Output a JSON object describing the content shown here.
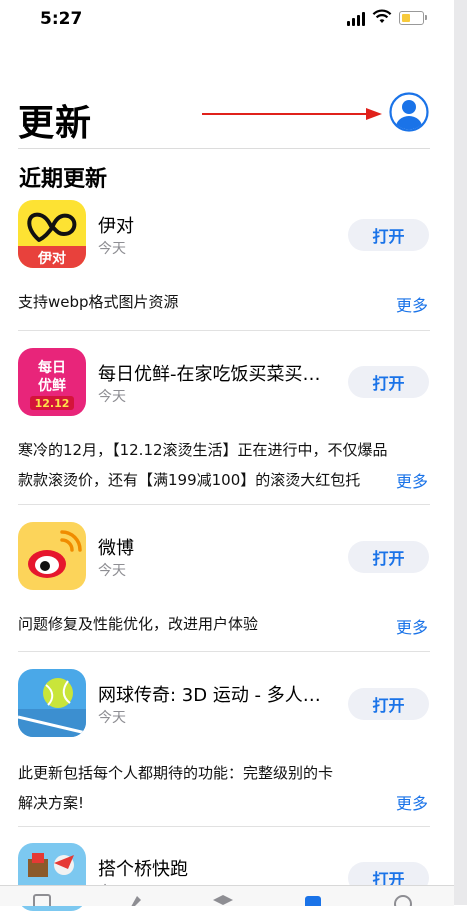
{
  "status_bar": {
    "time": "5:27"
  },
  "header": {
    "title": "更新"
  },
  "section": {
    "title": "近期更新"
  },
  "apps": [
    {
      "name": "伊对",
      "date": "今天",
      "button": "打开",
      "description": "支持webp格式图片资源",
      "more": "更多",
      "icon": "yidui-app-icon"
    },
    {
      "name": "每日优鲜-在家吃饭买菜买…",
      "date": "今天",
      "button": "打开",
      "description": "寒冷的12月，【12.12滚烫生活】正在进行中，不仅爆品款款滚烫价，还有【满199减100】的滚烫大红包托",
      "more": "更多",
      "icon": "meiriyouxian-app-icon"
    },
    {
      "name": "微博",
      "date": "今天",
      "button": "打开",
      "description": "问题修复及性能优化，改进用户体验",
      "more": "更多",
      "icon": "weibo-app-icon"
    },
    {
      "name": "网球传奇: 3D 运动 - 多人…",
      "date": "今天",
      "button": "打开",
      "description": "此更新包括每个人都期待的功能：完整级别的卡\n解决方案!",
      "more": "更多",
      "icon": "tennis-app-icon"
    },
    {
      "name": "搭个桥快跑",
      "date": "今天",
      "button": "打开",
      "icon": "bridge-app-icon"
    }
  ],
  "tab_bar": {
    "icons": [
      "today-tab-icon",
      "games-tab-icon",
      "apps-tab-icon",
      "updates-tab-icon",
      "search-tab-icon"
    ]
  },
  "colors": {
    "accent": "#1a73e8",
    "button_bg": "#eef0f6",
    "annotation_arrow": "#e0211b"
  }
}
